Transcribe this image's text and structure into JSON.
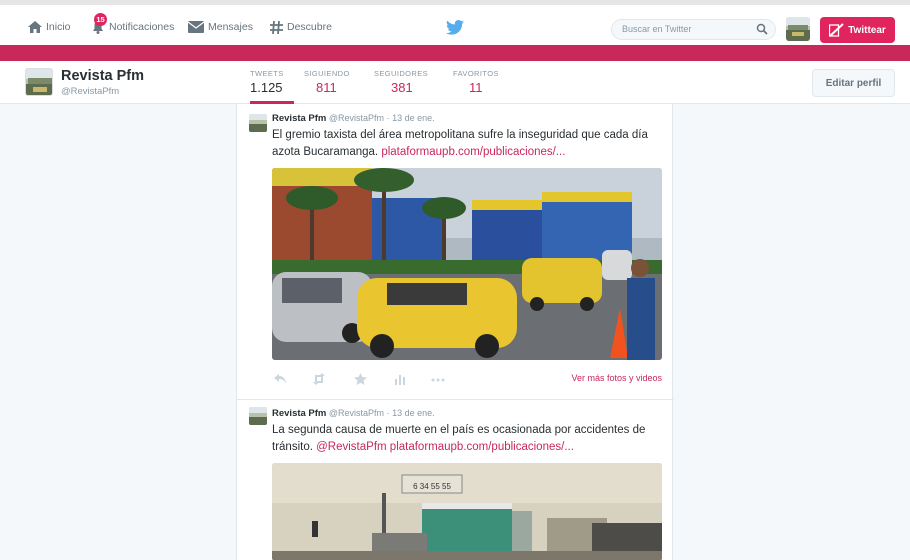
{
  "nav": {
    "home": "Inicio",
    "notifications": "Notificaciones",
    "notif_count": "15",
    "messages": "Mensajes",
    "discover": "Descubre",
    "search_placeholder": "Buscar en Twitter",
    "tweet_button": "Twittear"
  },
  "profile": {
    "name": "Revista Pfm",
    "handle": "@RevistaPfm",
    "edit_button": "Editar perfil",
    "stats": [
      {
        "label": "TWEETS",
        "value": "1.125"
      },
      {
        "label": "SIGUIENDO",
        "value": "811"
      },
      {
        "label": "SEGUIDORES",
        "value": "381"
      },
      {
        "label": "FAVORITOS",
        "value": "11"
      }
    ]
  },
  "tweets": [
    {
      "name": "Revista Pfm",
      "handle": "@RevistaPfm",
      "date": "· 13 de ene.",
      "text": "El gremio taxista del área metropolitana sufre la inseguridad que cada día azota Bucaramanga.",
      "link": "plataformaupb.com/publicaciones/...",
      "more": "Ver más fotos y videos"
    },
    {
      "name": "Revista Pfm",
      "handle": "@RevistaPfm",
      "date": "· 13 de ene.",
      "text": "La segunda causa de muerte en el país es ocasionada por accidentes de tránsito.",
      "mention": "@RevistaPfm",
      "link": "plataformaupb.com/publicaciones/...",
      "sign_text": "6 34 55 55"
    }
  ],
  "colors": {
    "accent": "#c8285a",
    "tweet_button": "#e0245e"
  }
}
